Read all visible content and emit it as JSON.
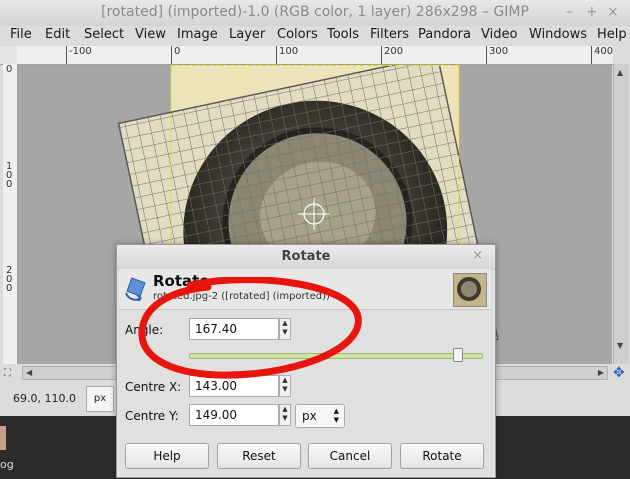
{
  "window": {
    "title": "[rotated] (imported)-1.0 (RGB color, 1 layer) 286x298 – GIMP",
    "controls": {
      "minimize": "–",
      "maximize": "+",
      "close": "×"
    }
  },
  "menubar": [
    "File",
    "Edit",
    "Select",
    "View",
    "Image",
    "Layer",
    "Colors",
    "Tools",
    "Filters",
    "Pandora",
    "Video",
    "Windows",
    "Help"
  ],
  "ruler": {
    "h_labels": [
      "-100",
      "0",
      "100",
      "200",
      "300",
      "400"
    ],
    "v_labels": [
      "0",
      "1\n0\n0",
      "2\n0\n0"
    ]
  },
  "statusbar": {
    "coords": "69.0, 110.0",
    "unit": "px"
  },
  "desktop": {
    "label": "og"
  },
  "dialog": {
    "title": "Rotate",
    "close": "×",
    "header_title": "Rotate",
    "header_subtitle": "rotated.jpg-2 ([rotated] (imported))",
    "angle_label": "Angle:",
    "angle_value": "167.40",
    "angle_fraction": 0.93,
    "centre_x_label": "Centre X:",
    "centre_x_value": "143.00",
    "centre_y_label": "Centre Y:",
    "centre_y_value": "149.00",
    "unit": "px",
    "buttons": {
      "help": "Help",
      "reset": "Reset",
      "cancel": "Cancel",
      "rotate": "Rotate"
    }
  },
  "colors": {
    "annotation": "#e8140e",
    "slider": "#9dbb6c",
    "guide": "#e7df00"
  }
}
